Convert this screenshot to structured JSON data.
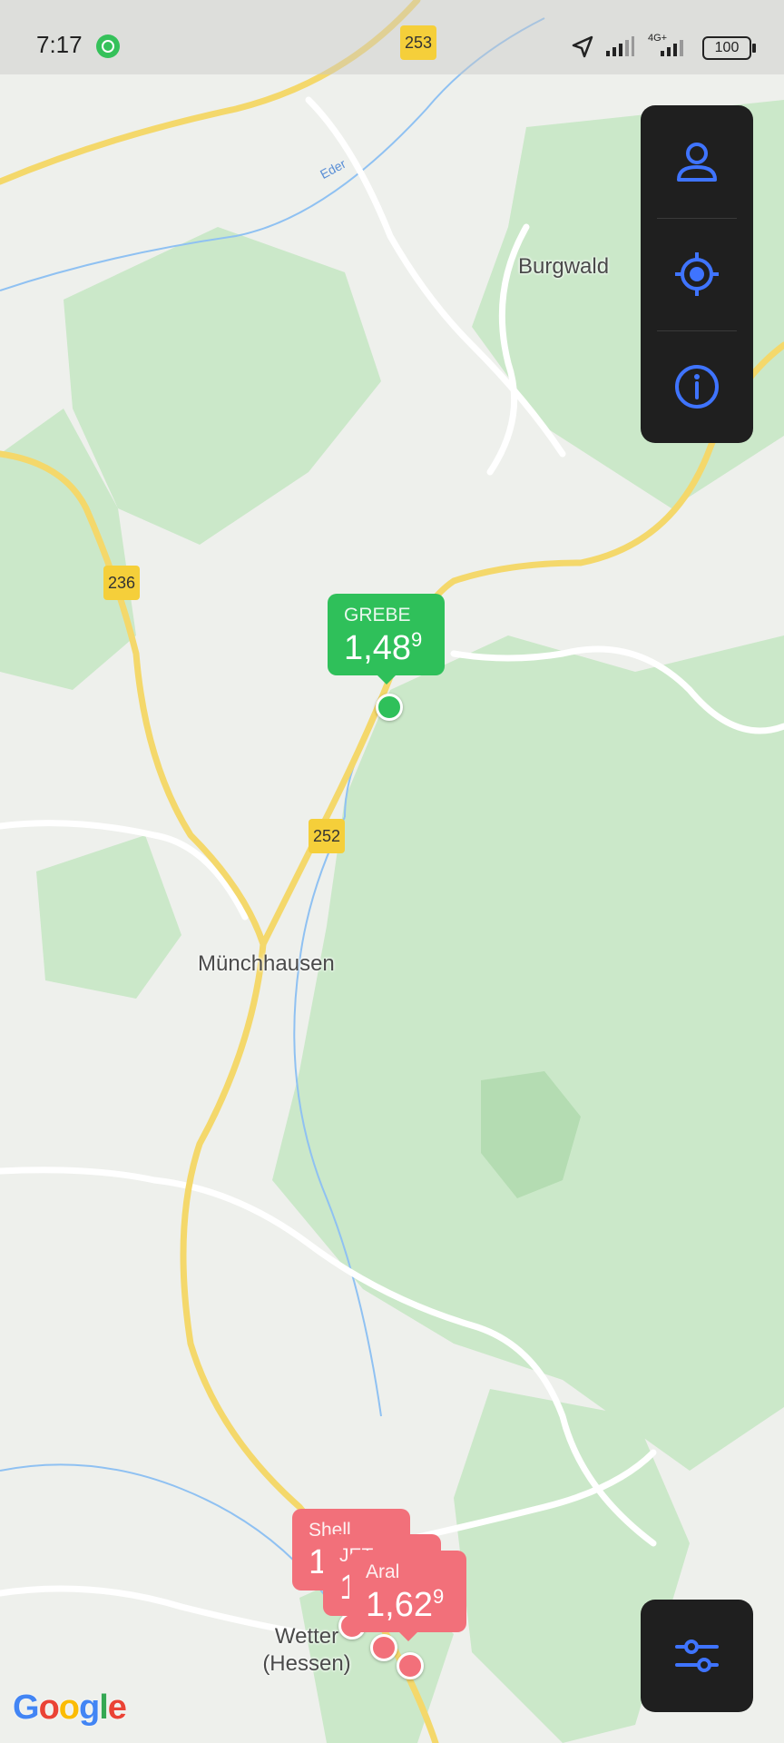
{
  "status_bar": {
    "time": "7:17",
    "network_label": "4G+",
    "battery": "100"
  },
  "map": {
    "road_shields": [
      "253",
      "236",
      "252"
    ],
    "places": [
      "Burgwald",
      "Münchhausen",
      "Wetter (Hessen)"
    ],
    "river": "Eder",
    "attribution": "Google"
  },
  "stations": [
    {
      "name": "GREBE",
      "price_main": "1,48",
      "price_sup": "9",
      "status": "cheap",
      "color": "#2fc05a"
    },
    {
      "name": "Shell",
      "price_main": "1",
      "price_sup": "",
      "status": "expensive",
      "color": "#f2707a"
    },
    {
      "name": "JET",
      "price_main": "1",
      "price_sup": "",
      "status": "expensive",
      "color": "#f2707a"
    },
    {
      "name": "Aral",
      "price_main": "1,62",
      "price_sup": "9",
      "status": "expensive",
      "color": "#f2707a"
    }
  ],
  "controls": {
    "profile_icon": "person-icon",
    "locate_icon": "location-target-icon",
    "info_icon": "info-icon",
    "filter_icon": "sliders-icon",
    "accent": "#3f74ff"
  }
}
